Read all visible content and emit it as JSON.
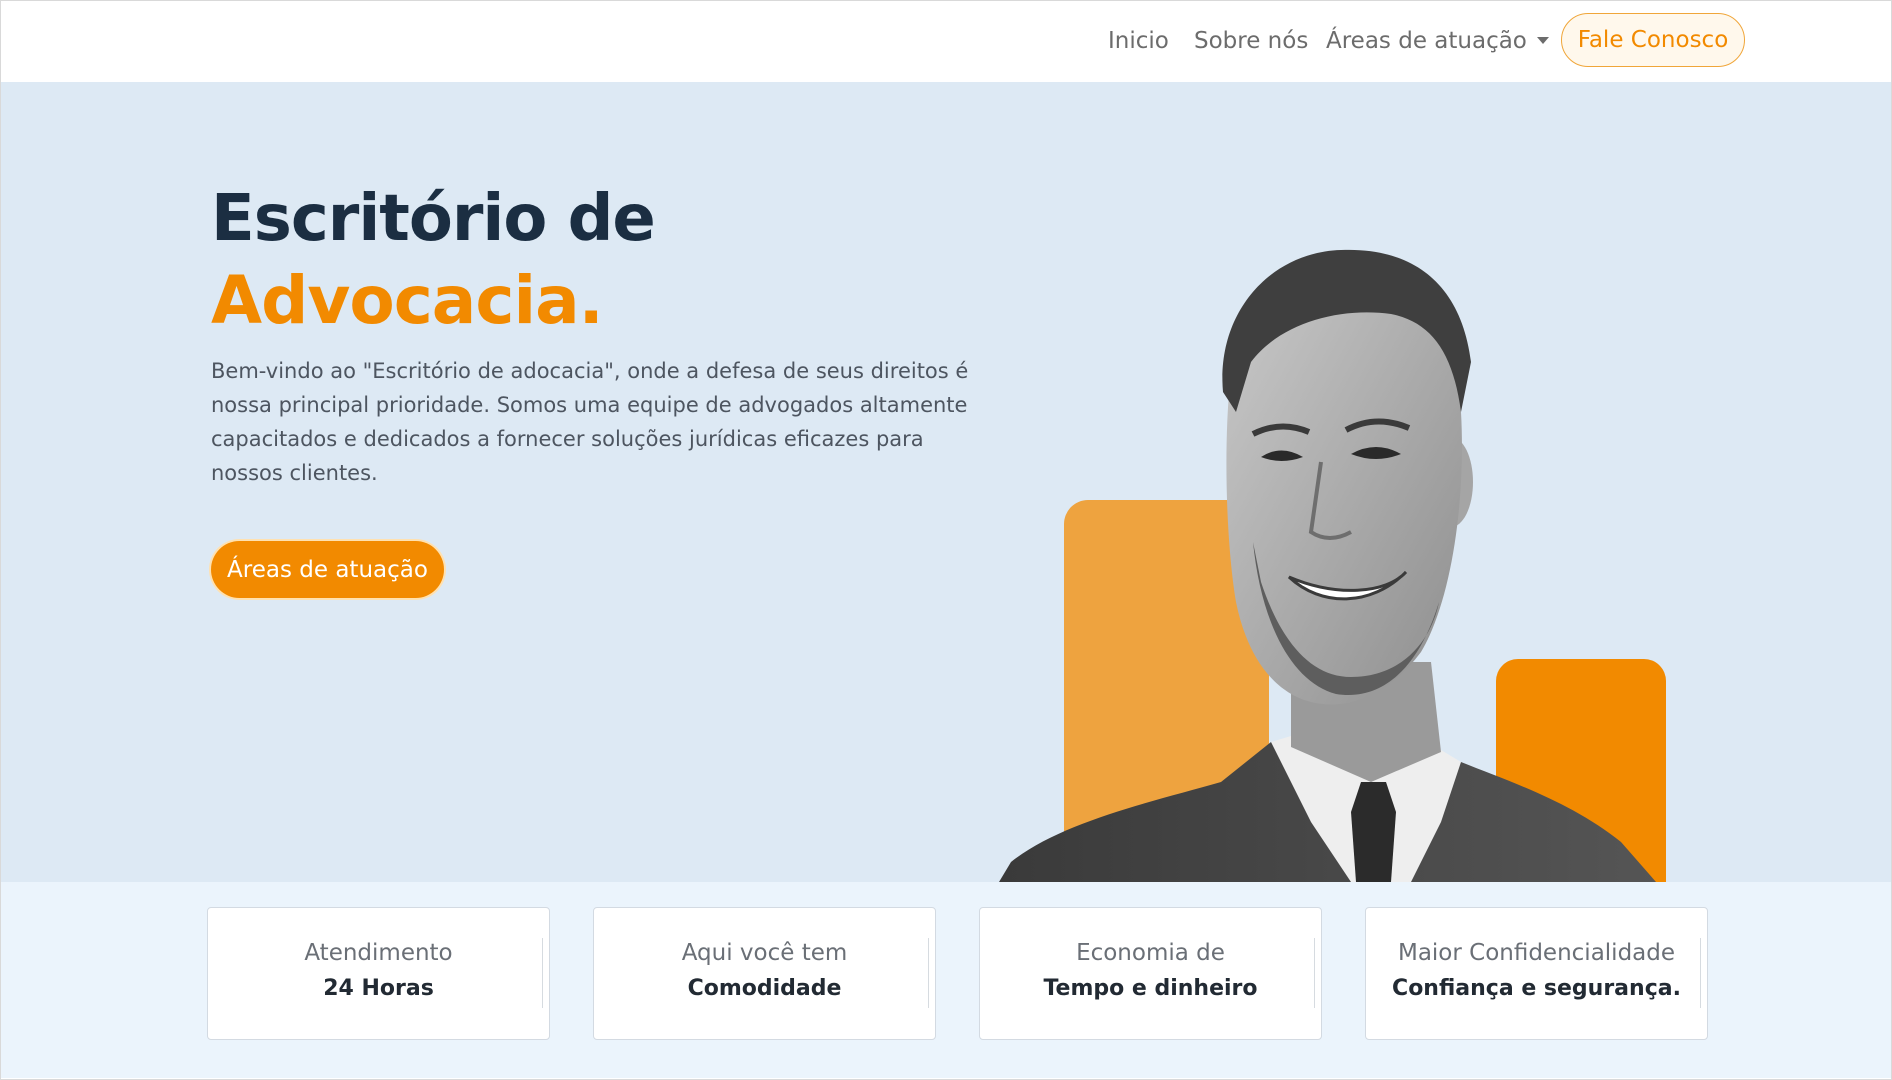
{
  "nav": {
    "items": [
      "Inicio",
      "Sobre nós",
      "Áreas de atuação"
    ],
    "cta": "Fale Conosco"
  },
  "hero": {
    "title_line1": "Escritório de",
    "title_line2": "Advocacia.",
    "description": "Bem-vindo ao \"Escritório de adocacia\", onde a defesa de seus direitos é nossa principal prioridade. Somos uma equipe de advogados altamente capacitados e dedicados a fornecer soluções jurídicas eficazes para nossos clientes.",
    "button": "Áreas de atuação"
  },
  "features": [
    {
      "line1": "Atendimento",
      "line2": "24 Horas"
    },
    {
      "line1": "Aqui você tem",
      "line2": "Comodidade"
    },
    {
      "line1": "Economia de",
      "line2": "Tempo e dinheiro"
    },
    {
      "line1": "Maior Confidencialidade",
      "line2": "Confiança e segurança."
    }
  ],
  "colors": {
    "accent": "#f28a00",
    "accent_light": "#eea33f",
    "heading": "#1b2e42",
    "hero_bg": "#dde9f4",
    "features_bg": "#ebf4fc"
  }
}
